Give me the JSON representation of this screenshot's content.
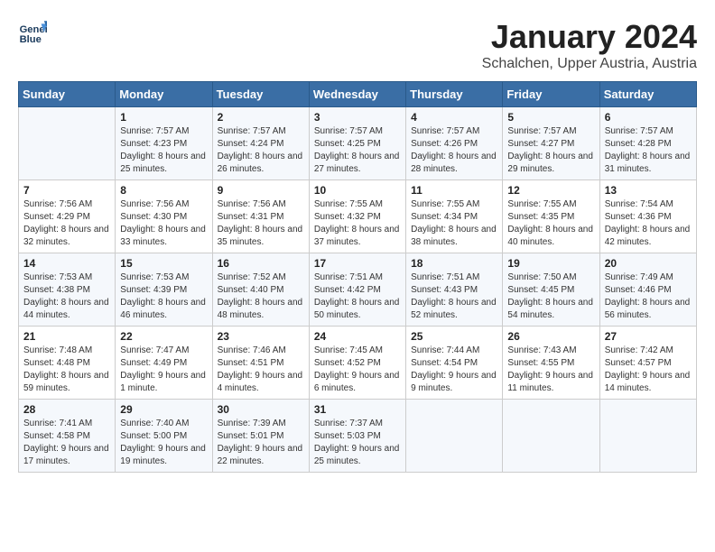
{
  "header": {
    "logo_line1": "General",
    "logo_line2": "Blue",
    "month_title": "January 2024",
    "location": "Schalchen, Upper Austria, Austria"
  },
  "weekdays": [
    "Sunday",
    "Monday",
    "Tuesday",
    "Wednesday",
    "Thursday",
    "Friday",
    "Saturday"
  ],
  "weeks": [
    [
      {
        "day": "",
        "sunrise": "",
        "sunset": "",
        "daylight": ""
      },
      {
        "day": "1",
        "sunrise": "Sunrise: 7:57 AM",
        "sunset": "Sunset: 4:23 PM",
        "daylight": "Daylight: 8 hours and 25 minutes."
      },
      {
        "day": "2",
        "sunrise": "Sunrise: 7:57 AM",
        "sunset": "Sunset: 4:24 PM",
        "daylight": "Daylight: 8 hours and 26 minutes."
      },
      {
        "day": "3",
        "sunrise": "Sunrise: 7:57 AM",
        "sunset": "Sunset: 4:25 PM",
        "daylight": "Daylight: 8 hours and 27 minutes."
      },
      {
        "day": "4",
        "sunrise": "Sunrise: 7:57 AM",
        "sunset": "Sunset: 4:26 PM",
        "daylight": "Daylight: 8 hours and 28 minutes."
      },
      {
        "day": "5",
        "sunrise": "Sunrise: 7:57 AM",
        "sunset": "Sunset: 4:27 PM",
        "daylight": "Daylight: 8 hours and 29 minutes."
      },
      {
        "day": "6",
        "sunrise": "Sunrise: 7:57 AM",
        "sunset": "Sunset: 4:28 PM",
        "daylight": "Daylight: 8 hours and 31 minutes."
      }
    ],
    [
      {
        "day": "7",
        "sunrise": "Sunrise: 7:56 AM",
        "sunset": "Sunset: 4:29 PM",
        "daylight": "Daylight: 8 hours and 32 minutes."
      },
      {
        "day": "8",
        "sunrise": "Sunrise: 7:56 AM",
        "sunset": "Sunset: 4:30 PM",
        "daylight": "Daylight: 8 hours and 33 minutes."
      },
      {
        "day": "9",
        "sunrise": "Sunrise: 7:56 AM",
        "sunset": "Sunset: 4:31 PM",
        "daylight": "Daylight: 8 hours and 35 minutes."
      },
      {
        "day": "10",
        "sunrise": "Sunrise: 7:55 AM",
        "sunset": "Sunset: 4:32 PM",
        "daylight": "Daylight: 8 hours and 37 minutes."
      },
      {
        "day": "11",
        "sunrise": "Sunrise: 7:55 AM",
        "sunset": "Sunset: 4:34 PM",
        "daylight": "Daylight: 8 hours and 38 minutes."
      },
      {
        "day": "12",
        "sunrise": "Sunrise: 7:55 AM",
        "sunset": "Sunset: 4:35 PM",
        "daylight": "Daylight: 8 hours and 40 minutes."
      },
      {
        "day": "13",
        "sunrise": "Sunrise: 7:54 AM",
        "sunset": "Sunset: 4:36 PM",
        "daylight": "Daylight: 8 hours and 42 minutes."
      }
    ],
    [
      {
        "day": "14",
        "sunrise": "Sunrise: 7:53 AM",
        "sunset": "Sunset: 4:38 PM",
        "daylight": "Daylight: 8 hours and 44 minutes."
      },
      {
        "day": "15",
        "sunrise": "Sunrise: 7:53 AM",
        "sunset": "Sunset: 4:39 PM",
        "daylight": "Daylight: 8 hours and 46 minutes."
      },
      {
        "day": "16",
        "sunrise": "Sunrise: 7:52 AM",
        "sunset": "Sunset: 4:40 PM",
        "daylight": "Daylight: 8 hours and 48 minutes."
      },
      {
        "day": "17",
        "sunrise": "Sunrise: 7:51 AM",
        "sunset": "Sunset: 4:42 PM",
        "daylight": "Daylight: 8 hours and 50 minutes."
      },
      {
        "day": "18",
        "sunrise": "Sunrise: 7:51 AM",
        "sunset": "Sunset: 4:43 PM",
        "daylight": "Daylight: 8 hours and 52 minutes."
      },
      {
        "day": "19",
        "sunrise": "Sunrise: 7:50 AM",
        "sunset": "Sunset: 4:45 PM",
        "daylight": "Daylight: 8 hours and 54 minutes."
      },
      {
        "day": "20",
        "sunrise": "Sunrise: 7:49 AM",
        "sunset": "Sunset: 4:46 PM",
        "daylight": "Daylight: 8 hours and 56 minutes."
      }
    ],
    [
      {
        "day": "21",
        "sunrise": "Sunrise: 7:48 AM",
        "sunset": "Sunset: 4:48 PM",
        "daylight": "Daylight: 8 hours and 59 minutes."
      },
      {
        "day": "22",
        "sunrise": "Sunrise: 7:47 AM",
        "sunset": "Sunset: 4:49 PM",
        "daylight": "Daylight: 9 hours and 1 minute."
      },
      {
        "day": "23",
        "sunrise": "Sunrise: 7:46 AM",
        "sunset": "Sunset: 4:51 PM",
        "daylight": "Daylight: 9 hours and 4 minutes."
      },
      {
        "day": "24",
        "sunrise": "Sunrise: 7:45 AM",
        "sunset": "Sunset: 4:52 PM",
        "daylight": "Daylight: 9 hours and 6 minutes."
      },
      {
        "day": "25",
        "sunrise": "Sunrise: 7:44 AM",
        "sunset": "Sunset: 4:54 PM",
        "daylight": "Daylight: 9 hours and 9 minutes."
      },
      {
        "day": "26",
        "sunrise": "Sunrise: 7:43 AM",
        "sunset": "Sunset: 4:55 PM",
        "daylight": "Daylight: 9 hours and 11 minutes."
      },
      {
        "day": "27",
        "sunrise": "Sunrise: 7:42 AM",
        "sunset": "Sunset: 4:57 PM",
        "daylight": "Daylight: 9 hours and 14 minutes."
      }
    ],
    [
      {
        "day": "28",
        "sunrise": "Sunrise: 7:41 AM",
        "sunset": "Sunset: 4:58 PM",
        "daylight": "Daylight: 9 hours and 17 minutes."
      },
      {
        "day": "29",
        "sunrise": "Sunrise: 7:40 AM",
        "sunset": "Sunset: 5:00 PM",
        "daylight": "Daylight: 9 hours and 19 minutes."
      },
      {
        "day": "30",
        "sunrise": "Sunrise: 7:39 AM",
        "sunset": "Sunset: 5:01 PM",
        "daylight": "Daylight: 9 hours and 22 minutes."
      },
      {
        "day": "31",
        "sunrise": "Sunrise: 7:37 AM",
        "sunset": "Sunset: 5:03 PM",
        "daylight": "Daylight: 9 hours and 25 minutes."
      },
      {
        "day": "",
        "sunrise": "",
        "sunset": "",
        "daylight": ""
      },
      {
        "day": "",
        "sunrise": "",
        "sunset": "",
        "daylight": ""
      },
      {
        "day": "",
        "sunrise": "",
        "sunset": "",
        "daylight": ""
      }
    ]
  ]
}
